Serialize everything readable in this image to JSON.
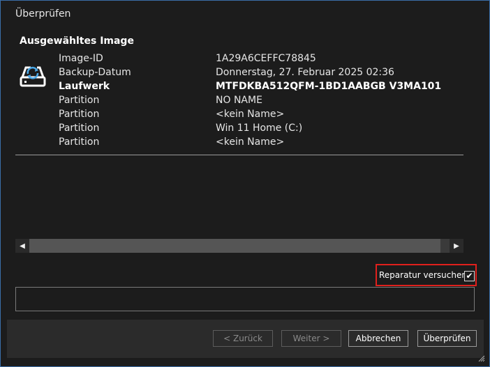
{
  "window": {
    "title": "Überprüfen"
  },
  "section": {
    "title": "Ausgewähltes Image"
  },
  "icon": {
    "drive": "drive-sync-icon"
  },
  "details": [
    {
      "label": "Image-ID",
      "value": "1A29A6CEFFC78845",
      "bold": false
    },
    {
      "label": "Backup-Datum",
      "value": "Donnerstag, 27. Februar 2025 02:36",
      "bold": false
    },
    {
      "label": "Laufwerk",
      "value": "MTFDKBA512QFM-1BD1AABGB V3MA101",
      "bold": true
    },
    {
      "label": "Partition",
      "value": "NO NAME",
      "bold": false
    },
    {
      "label": "Partition",
      "value": "<kein Name>",
      "bold": false
    },
    {
      "label": "Partition",
      "value": "Win 11 Home (C:)",
      "bold": false
    },
    {
      "label": "Partition",
      "value": "<kein Name>",
      "bold": false
    }
  ],
  "repair": {
    "label": "Reparatur versuchen",
    "checked": true
  },
  "output": {
    "text": ""
  },
  "buttons": {
    "back": "< Zurück",
    "next": "Weiter >",
    "cancel": "Abbrechen",
    "verify": "Überprüfen"
  },
  "colors": {
    "highlight": "#e0201c",
    "background": "#1c1c1c"
  }
}
